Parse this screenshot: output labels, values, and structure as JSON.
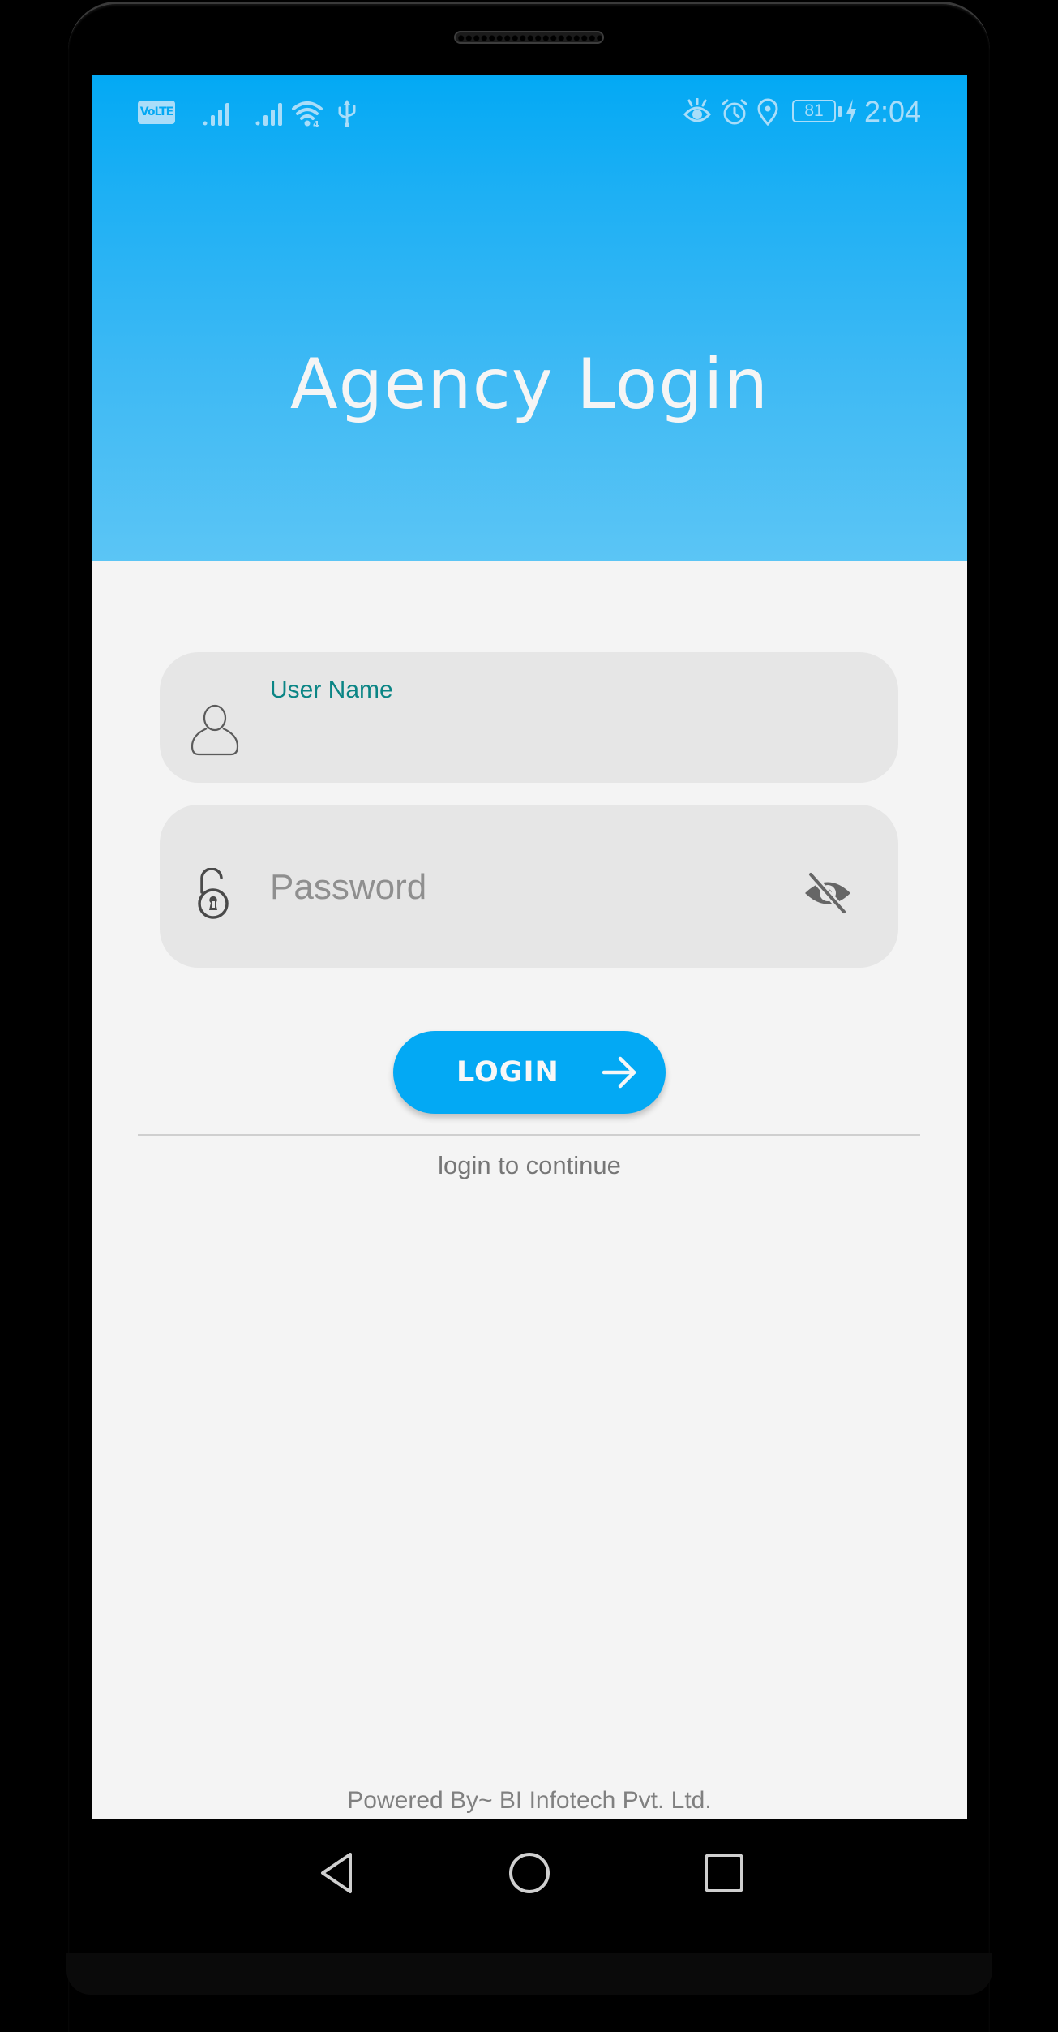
{
  "status_bar": {
    "volte_label": "VoLTE",
    "left_icons": [
      "volte-icon",
      "signal-sim1-icon",
      "signal-sim2-icon",
      "wifi-icon",
      "usb-icon"
    ],
    "right_icons": [
      "eye-comfort-icon",
      "alarm-icon",
      "location-icon"
    ],
    "battery_level": "81",
    "charging": true,
    "time": "2:04",
    "icon_color": "#a9ddf9"
  },
  "header": {
    "title": "Agency Login",
    "gradient_top": "#03a9f4",
    "gradient_bottom": "#5bc5f5"
  },
  "form": {
    "username": {
      "label": "User Name",
      "value": "",
      "icon": "person-outline-icon",
      "label_color": "#0b8585"
    },
    "password": {
      "placeholder": "Password",
      "value": "",
      "icon": "lock-open-icon",
      "toggle_icon": "visibility-off-icon"
    },
    "login_button": {
      "label": "LOGIN",
      "icon": "arrow-right-icon",
      "color": "#03a9f4"
    },
    "subtitle": "login to continue"
  },
  "footer": {
    "text": "Powered By~ BI Infotech Pvt. Ltd."
  },
  "nav_bar": {
    "buttons": [
      "back",
      "home",
      "recents"
    ]
  }
}
